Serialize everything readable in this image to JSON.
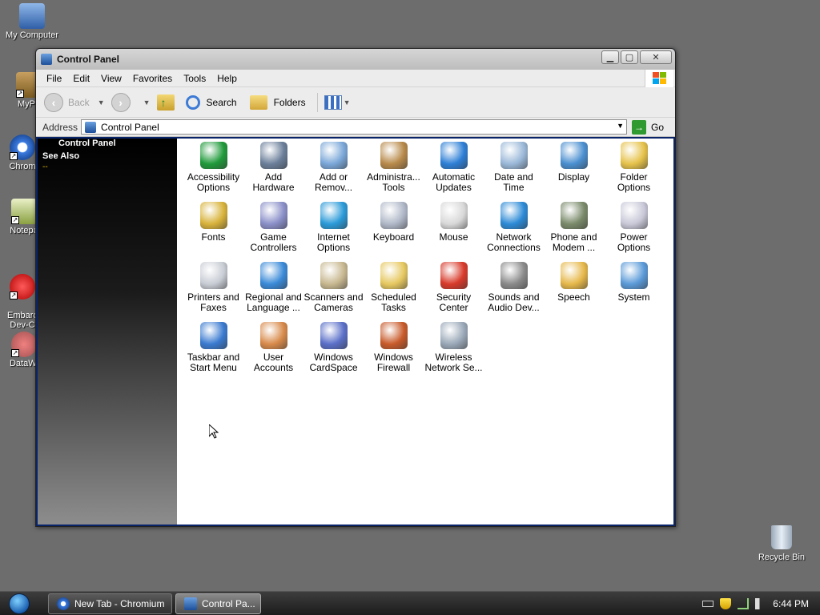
{
  "desktop": {
    "icons": [
      {
        "label": "My Computer"
      },
      {
        "label": "MyPa"
      },
      {
        "label": "Chrom"
      },
      {
        "label": "Notepa"
      },
      {
        "label": "Embarc\nDev-C"
      },
      {
        "label": "DataWi"
      }
    ],
    "recycle_bin": "Recycle Bin"
  },
  "window": {
    "title": "Control Panel",
    "menu": [
      "File",
      "Edit",
      "View",
      "Favorites",
      "Tools",
      "Help"
    ],
    "toolbar": {
      "back": "Back",
      "search": "Search",
      "folders": "Folders"
    },
    "address": {
      "label": "Address",
      "value": "Control Panel",
      "go": "Go"
    },
    "sidebar": {
      "title": "Control Panel",
      "see_also": "See Also",
      "dash": "--"
    },
    "items": [
      {
        "line1": "Accessibility",
        "line2": "Options",
        "icon": "accessibility-icon"
      },
      {
        "line1": "Add",
        "line2": "Hardware",
        "icon": "add-hardware-icon"
      },
      {
        "line1": "Add or",
        "line2": "Remov...",
        "icon": "add-remove-icon"
      },
      {
        "line1": "Administra...",
        "line2": "Tools",
        "icon": "admin-tools-icon"
      },
      {
        "line1": "Automatic",
        "line2": "Updates",
        "icon": "updates-icon"
      },
      {
        "line1": "Date and",
        "line2": "Time",
        "icon": "clock-icon"
      },
      {
        "line1": "Display",
        "line2": "",
        "icon": "display-icon"
      },
      {
        "line1": "Folder",
        "line2": "Options",
        "icon": "folder-options-icon"
      },
      {
        "line1": "Fonts",
        "line2": "",
        "icon": "fonts-icon"
      },
      {
        "line1": "Game",
        "line2": "Controllers",
        "icon": "gamepad-icon"
      },
      {
        "line1": "Internet",
        "line2": "Options",
        "icon": "internet-icon"
      },
      {
        "line1": "Keyboard",
        "line2": "",
        "icon": "keyboard-icon"
      },
      {
        "line1": "Mouse",
        "line2": "",
        "icon": "mouse-icon"
      },
      {
        "line1": "Network",
        "line2": "Connections",
        "icon": "network-icon"
      },
      {
        "line1": "Phone and",
        "line2": "Modem ...",
        "icon": "phone-icon"
      },
      {
        "line1": "Power",
        "line2": "Options",
        "icon": "power-icon"
      },
      {
        "line1": "Printers and",
        "line2": "Faxes",
        "icon": "printer-icon"
      },
      {
        "line1": "Regional and",
        "line2": "Language ...",
        "icon": "globe-icon"
      },
      {
        "line1": "Scanners and",
        "line2": "Cameras",
        "icon": "scanner-icon"
      },
      {
        "line1": "Scheduled",
        "line2": "Tasks",
        "icon": "tasks-icon"
      },
      {
        "line1": "Security",
        "line2": "Center",
        "icon": "shield-icon"
      },
      {
        "line1": "Sounds and",
        "line2": "Audio Dev...",
        "icon": "speaker-icon"
      },
      {
        "line1": "Speech",
        "line2": "",
        "icon": "speech-icon"
      },
      {
        "line1": "System",
        "line2": "",
        "icon": "system-icon"
      },
      {
        "line1": "Taskbar and",
        "line2": "Start Menu",
        "icon": "taskbar-icon"
      },
      {
        "line1": "User",
        "line2": "Accounts",
        "icon": "users-icon"
      },
      {
        "line1": "Windows",
        "line2": "CardSpace",
        "icon": "cardspace-icon"
      },
      {
        "line1": "Windows",
        "line2": "Firewall",
        "icon": "firewall-icon"
      },
      {
        "line1": "Wireless",
        "line2": "Network Se...",
        "icon": "wireless-icon"
      }
    ]
  },
  "taskbar": {
    "tasks": [
      {
        "label": "New Tab - Chromium"
      },
      {
        "label": "Control Pa..."
      }
    ],
    "clock": "6:44 PM"
  },
  "colors": {
    "desktop": "#6d6d6d",
    "sidebar_top": "#000000",
    "go_green": "#2f9a2f"
  }
}
